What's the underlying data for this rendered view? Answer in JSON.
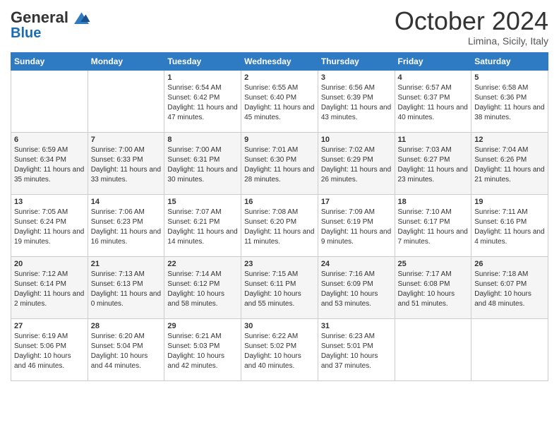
{
  "logo": {
    "line1": "General",
    "line2": "Blue"
  },
  "title": "October 2024",
  "subtitle": "Limina, Sicily, Italy",
  "days_of_week": [
    "Sunday",
    "Monday",
    "Tuesday",
    "Wednesday",
    "Thursday",
    "Friday",
    "Saturday"
  ],
  "weeks": [
    [
      {
        "day": "",
        "info": ""
      },
      {
        "day": "",
        "info": ""
      },
      {
        "day": "1",
        "info": "Sunrise: 6:54 AM\nSunset: 6:42 PM\nDaylight: 11 hours and 47 minutes."
      },
      {
        "day": "2",
        "info": "Sunrise: 6:55 AM\nSunset: 6:40 PM\nDaylight: 11 hours and 45 minutes."
      },
      {
        "day": "3",
        "info": "Sunrise: 6:56 AM\nSunset: 6:39 PM\nDaylight: 11 hours and 43 minutes."
      },
      {
        "day": "4",
        "info": "Sunrise: 6:57 AM\nSunset: 6:37 PM\nDaylight: 11 hours and 40 minutes."
      },
      {
        "day": "5",
        "info": "Sunrise: 6:58 AM\nSunset: 6:36 PM\nDaylight: 11 hours and 38 minutes."
      }
    ],
    [
      {
        "day": "6",
        "info": "Sunrise: 6:59 AM\nSunset: 6:34 PM\nDaylight: 11 hours and 35 minutes."
      },
      {
        "day": "7",
        "info": "Sunrise: 7:00 AM\nSunset: 6:33 PM\nDaylight: 11 hours and 33 minutes."
      },
      {
        "day": "8",
        "info": "Sunrise: 7:00 AM\nSunset: 6:31 PM\nDaylight: 11 hours and 30 minutes."
      },
      {
        "day": "9",
        "info": "Sunrise: 7:01 AM\nSunset: 6:30 PM\nDaylight: 11 hours and 28 minutes."
      },
      {
        "day": "10",
        "info": "Sunrise: 7:02 AM\nSunset: 6:29 PM\nDaylight: 11 hours and 26 minutes."
      },
      {
        "day": "11",
        "info": "Sunrise: 7:03 AM\nSunset: 6:27 PM\nDaylight: 11 hours and 23 minutes."
      },
      {
        "day": "12",
        "info": "Sunrise: 7:04 AM\nSunset: 6:26 PM\nDaylight: 11 hours and 21 minutes."
      }
    ],
    [
      {
        "day": "13",
        "info": "Sunrise: 7:05 AM\nSunset: 6:24 PM\nDaylight: 11 hours and 19 minutes."
      },
      {
        "day": "14",
        "info": "Sunrise: 7:06 AM\nSunset: 6:23 PM\nDaylight: 11 hours and 16 minutes."
      },
      {
        "day": "15",
        "info": "Sunrise: 7:07 AM\nSunset: 6:21 PM\nDaylight: 11 hours and 14 minutes."
      },
      {
        "day": "16",
        "info": "Sunrise: 7:08 AM\nSunset: 6:20 PM\nDaylight: 11 hours and 11 minutes."
      },
      {
        "day": "17",
        "info": "Sunrise: 7:09 AM\nSunset: 6:19 PM\nDaylight: 11 hours and 9 minutes."
      },
      {
        "day": "18",
        "info": "Sunrise: 7:10 AM\nSunset: 6:17 PM\nDaylight: 11 hours and 7 minutes."
      },
      {
        "day": "19",
        "info": "Sunrise: 7:11 AM\nSunset: 6:16 PM\nDaylight: 11 hours and 4 minutes."
      }
    ],
    [
      {
        "day": "20",
        "info": "Sunrise: 7:12 AM\nSunset: 6:14 PM\nDaylight: 11 hours and 2 minutes."
      },
      {
        "day": "21",
        "info": "Sunrise: 7:13 AM\nSunset: 6:13 PM\nDaylight: 11 hours and 0 minutes."
      },
      {
        "day": "22",
        "info": "Sunrise: 7:14 AM\nSunset: 6:12 PM\nDaylight: 10 hours and 58 minutes."
      },
      {
        "day": "23",
        "info": "Sunrise: 7:15 AM\nSunset: 6:11 PM\nDaylight: 10 hours and 55 minutes."
      },
      {
        "day": "24",
        "info": "Sunrise: 7:16 AM\nSunset: 6:09 PM\nDaylight: 10 hours and 53 minutes."
      },
      {
        "day": "25",
        "info": "Sunrise: 7:17 AM\nSunset: 6:08 PM\nDaylight: 10 hours and 51 minutes."
      },
      {
        "day": "26",
        "info": "Sunrise: 7:18 AM\nSunset: 6:07 PM\nDaylight: 10 hours and 48 minutes."
      }
    ],
    [
      {
        "day": "27",
        "info": "Sunrise: 6:19 AM\nSunset: 5:06 PM\nDaylight: 10 hours and 46 minutes."
      },
      {
        "day": "28",
        "info": "Sunrise: 6:20 AM\nSunset: 5:04 PM\nDaylight: 10 hours and 44 minutes."
      },
      {
        "day": "29",
        "info": "Sunrise: 6:21 AM\nSunset: 5:03 PM\nDaylight: 10 hours and 42 minutes."
      },
      {
        "day": "30",
        "info": "Sunrise: 6:22 AM\nSunset: 5:02 PM\nDaylight: 10 hours and 40 minutes."
      },
      {
        "day": "31",
        "info": "Sunrise: 6:23 AM\nSunset: 5:01 PM\nDaylight: 10 hours and 37 minutes."
      },
      {
        "day": "",
        "info": ""
      },
      {
        "day": "",
        "info": ""
      }
    ]
  ]
}
